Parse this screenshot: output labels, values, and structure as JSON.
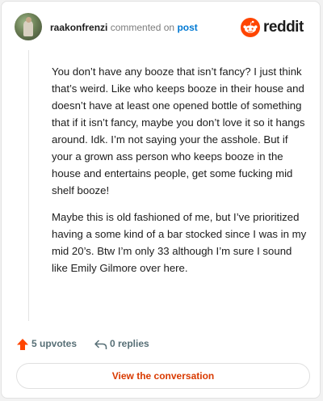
{
  "header": {
    "username": "raakonfrenzi",
    "commented_on": "commented on",
    "post_link": "post",
    "brand": "reddit",
    "brand_color": "#ff4500"
  },
  "comment": {
    "paragraphs": [
      "You don’t have any booze that isn’t fancy? I just think that’s weird. Like who keeps booze in their house and doesn’t have at least one opened bottle of something that if it isn’t fancy, maybe you don’t love it so it hangs around. Idk. I’m not saying your the asshole. But if your a grown ass person who keeps booze in the house and entertains people, get some fucking mid shelf booze!",
      "Maybe this is old fashioned of me, but I’ve prioritized having a some kind of a bar stocked since I was in my mid 20’s. Btw I’m only 33 although I’m sure I sound like Emily Gilmore over here."
    ]
  },
  "actions": {
    "upvotes": "5 upvotes",
    "replies": "0 replies",
    "upvote_icon": "upvote-arrow-icon",
    "reply_icon": "reply-arrow-icon"
  },
  "footer": {
    "button_label": "View the conversation",
    "accent": "#d93a00"
  }
}
